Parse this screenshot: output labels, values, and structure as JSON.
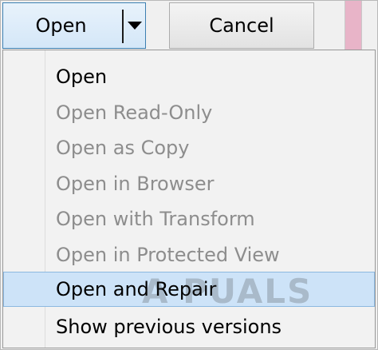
{
  "toolbar": {
    "open_label": "Open",
    "cancel_label": "Cancel"
  },
  "menu": {
    "items": [
      {
        "label": "Open",
        "enabled": true
      },
      {
        "label": "Open Read-Only",
        "enabled": false
      },
      {
        "label": "Open as Copy",
        "enabled": false
      },
      {
        "label": "Open in Browser",
        "enabled": false
      },
      {
        "label": "Open with Transform",
        "enabled": false
      },
      {
        "label": "Open in Protected View",
        "enabled": false
      },
      {
        "label": "Open and Repair",
        "enabled": true,
        "highlighted": true
      },
      {
        "label": "Show previous versions",
        "enabled": true
      }
    ]
  },
  "watermark": {
    "text": "A PUALS"
  },
  "colors": {
    "highlight": "#cde3f8",
    "disabled_text": "#8d8d8d",
    "accent_strip": "#e8b4c8"
  }
}
